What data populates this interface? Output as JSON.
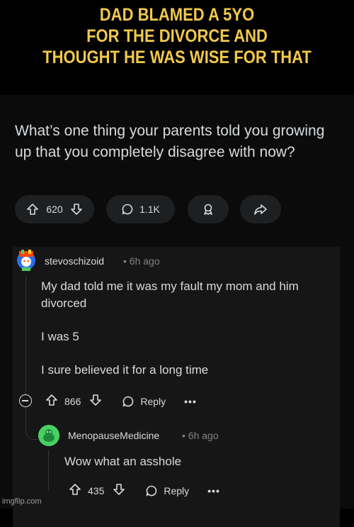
{
  "meme": {
    "caption_lines": [
      "DAD BLAMED A 5YO",
      "FOR THE DIVORCE AND",
      "THOUGHT HE WAS WISE FOR THAT"
    ],
    "watermark": "imgflip.com",
    "caption_color": "#f2c94c"
  },
  "post": {
    "title": "What’s one thing your parents told you growing up that you completely disagree with now?",
    "upvotes": "620",
    "comments": "1.1K",
    "icons": [
      "upvote-arrow-icon",
      "downvote-arrow-icon",
      "comment-bubble-icon",
      "award-icon",
      "share-icon"
    ]
  },
  "comments": [
    {
      "author": "stevoschizoid",
      "time": "• 6h ago",
      "body": [
        "My dad told me it was my fault my mom and him divorced",
        "I was 5",
        "I sure believed it for a long time"
      ],
      "votes": "866",
      "reply_label": "Reply",
      "more": "•••"
    },
    {
      "author": "MenopauseMedicine",
      "time": "• 6h ago",
      "body": "Wow what an asshole",
      "votes": "435",
      "reply_label": "Reply",
      "more": "•••"
    }
  ],
  "colors": {
    "background": "#0b0b0c",
    "card": "#161617",
    "pill": "#1e1f21",
    "text": "#d7dadc",
    "muted": "#818384"
  }
}
